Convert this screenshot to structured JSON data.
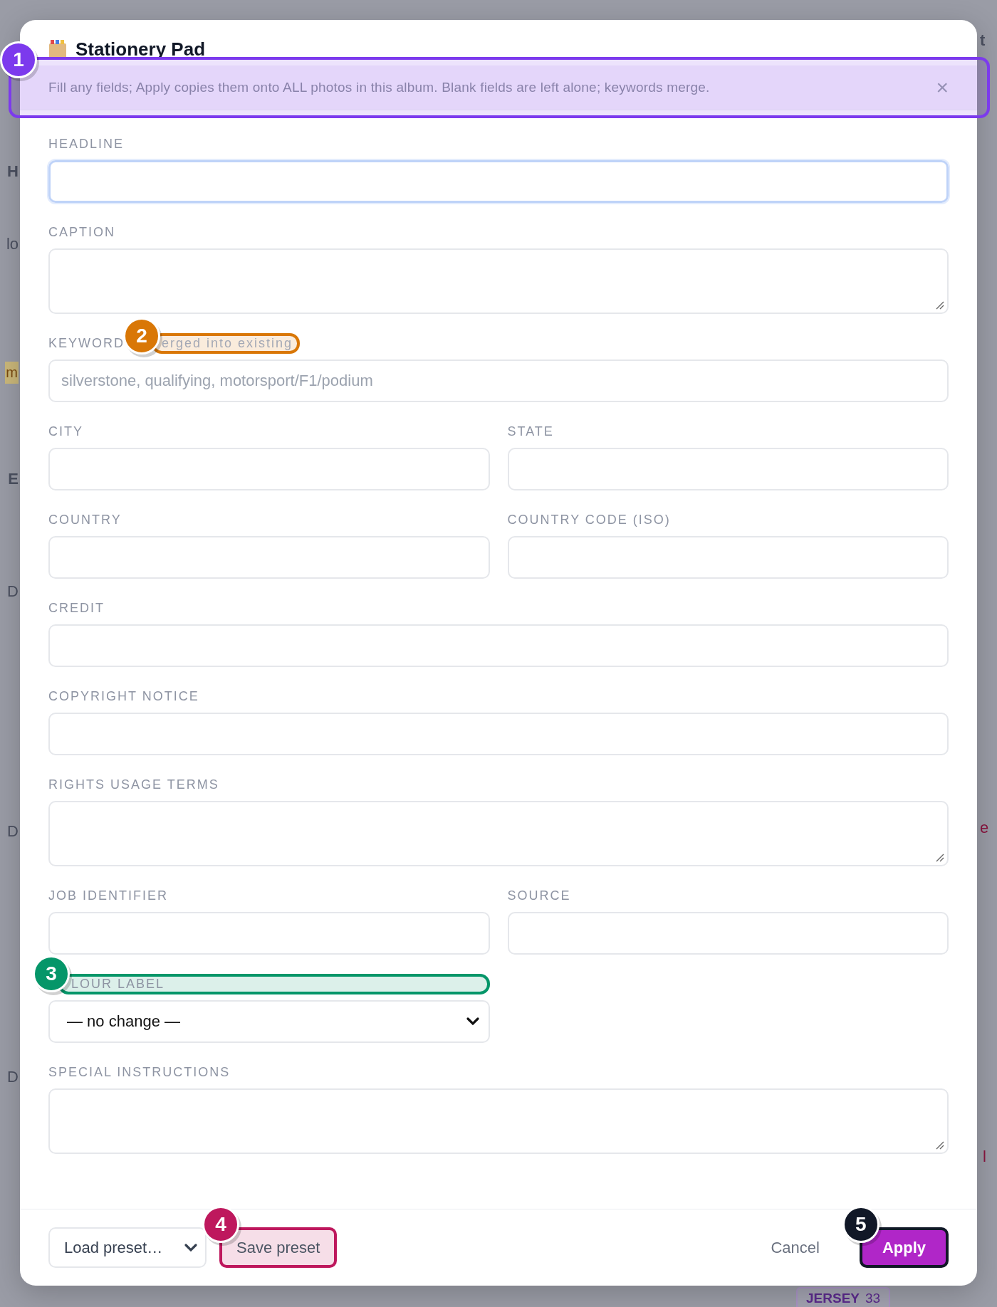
{
  "backdrop": {
    "fragments": [
      {
        "text": "H",
        "kind": "heading"
      },
      {
        "text": "lo",
        "kind": "plain"
      },
      {
        "text": "m",
        "kind": "tag"
      },
      {
        "text": "E",
        "kind": "heading"
      },
      {
        "text": "D",
        "kind": "plain"
      },
      {
        "text": "D",
        "kind": "plain"
      },
      {
        "text": "D",
        "kind": "plain"
      },
      {
        "text": "t",
        "kind": "heading"
      },
      {
        "text": "e",
        "kind": "alert"
      },
      {
        "text": "l",
        "kind": "alert"
      }
    ],
    "chip": {
      "label": "JERSEY",
      "count": "33"
    }
  },
  "dialog": {
    "title": "Stationery Pad",
    "banner": {
      "text": "Fill any fields; Apply copies them onto ALL photos in this album. Blank fields are left alone; keywords merge.",
      "close": "×",
      "annotation": {
        "number": "1",
        "color": "#7c3aed"
      }
    },
    "form_rows": [
      {
        "fields": [
          {
            "label": "HEADLINE",
            "kind": "input",
            "focused": true
          }
        ]
      },
      {
        "fields": [
          {
            "label": "CAPTION",
            "kind": "textarea",
            "focused": false
          }
        ]
      },
      {
        "fields": [
          {
            "label": "KEYWORD",
            "hint": "erged into existing",
            "kind": "input",
            "placeholder": "silverstone, qualifying, motorsport/F1/podium",
            "focused": false,
            "annotation": {
              "number": "2",
              "color": "#d97706"
            }
          }
        ]
      },
      {
        "fields": [
          {
            "label": "CITY",
            "kind": "input",
            "focused": false
          },
          {
            "label": "STATE",
            "kind": "input",
            "focused": false
          }
        ]
      },
      {
        "fields": [
          {
            "label": "COUNTRY",
            "kind": "input",
            "focused": false
          },
          {
            "label": "COUNTRY CODE (ISO)",
            "kind": "input",
            "focused": false
          }
        ]
      },
      {
        "fields": [
          {
            "label": "CREDIT",
            "kind": "input",
            "focused": false
          }
        ]
      },
      {
        "fields": [
          {
            "label": "COPYRIGHT NOTICE",
            "kind": "input",
            "focused": false
          }
        ]
      },
      {
        "fields": [
          {
            "label": "RIGHTS USAGE TERMS",
            "kind": "textarea",
            "focused": false
          }
        ]
      },
      {
        "fields": [
          {
            "label": "JOB IDENTIFIER",
            "kind": "input",
            "focused": false
          },
          {
            "label": "SOURCE",
            "kind": "input",
            "focused": false
          }
        ]
      },
      {
        "fields": [
          {
            "label": "LOUR LABEL",
            "kind": "select",
            "value": "— no change —",
            "focused": false,
            "annotation": {
              "number": "3",
              "color": "#059669"
            }
          },
          {
            "kind": "empty"
          }
        ]
      },
      {
        "fields": [
          {
            "label": "SPECIAL INSTRUCTIONS",
            "kind": "textarea",
            "focused": false
          }
        ]
      }
    ],
    "footer": {
      "left": [
        {
          "label": "Load preset…",
          "kind": "select"
        },
        {
          "label": "Save preset",
          "kind": "secondary",
          "annotation": {
            "number": "4",
            "color": "#be185d"
          }
        }
      ],
      "right": [
        {
          "label": "Cancel",
          "kind": "link"
        },
        {
          "label": "Apply",
          "kind": "primary",
          "annotation": {
            "number": "5",
            "color": "#111827"
          }
        }
      ]
    }
  }
}
